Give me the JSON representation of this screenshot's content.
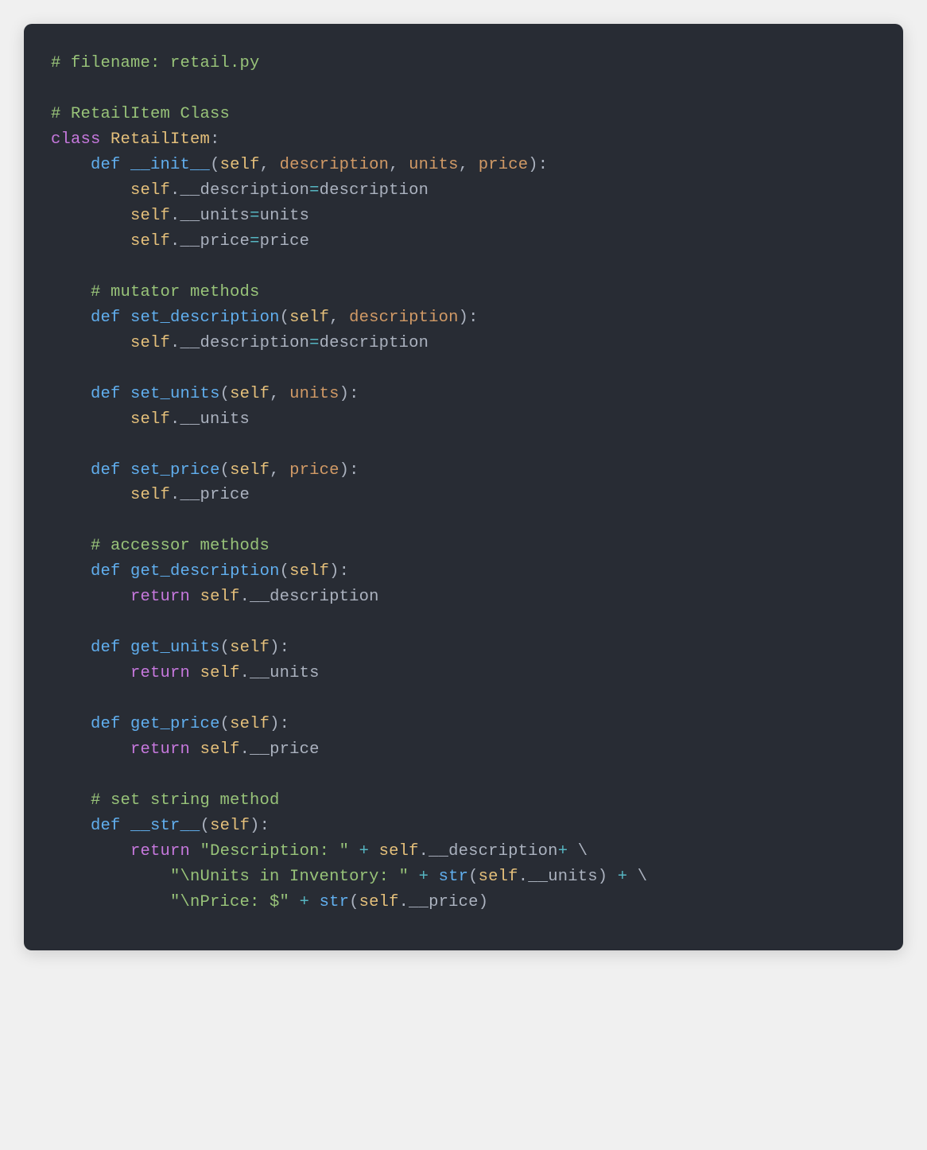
{
  "code": {
    "comment_filename": "# filename: retail.py",
    "comment_class": "# RetailItem Class",
    "kw_class": "class",
    "class_name": "RetailItem",
    "kw_def": "def",
    "self": "self",
    "kw_return": "return",
    "fn_init": "__init__",
    "p_description": "description",
    "p_units": "units",
    "p_price": "price",
    "attr_description": ".__description",
    "attr_units": ".__units",
    "attr_price": ".__price",
    "comment_mutator": "# mutator methods",
    "fn_set_description": "set_description",
    "fn_set_units": "set_units",
    "fn_set_price": "set_price",
    "comment_accessor": "# accessor methods",
    "fn_get_description": "get_description",
    "fn_get_units": "get_units",
    "fn_get_price": "get_price",
    "comment_str": "# set string method",
    "fn_str": "__str__",
    "str_description": "\"Description: \"",
    "str_units": "\"\\nUnits in Inventory: \"",
    "str_price": "\"\\nPrice: $\"",
    "fn_str_builtin": "str"
  }
}
